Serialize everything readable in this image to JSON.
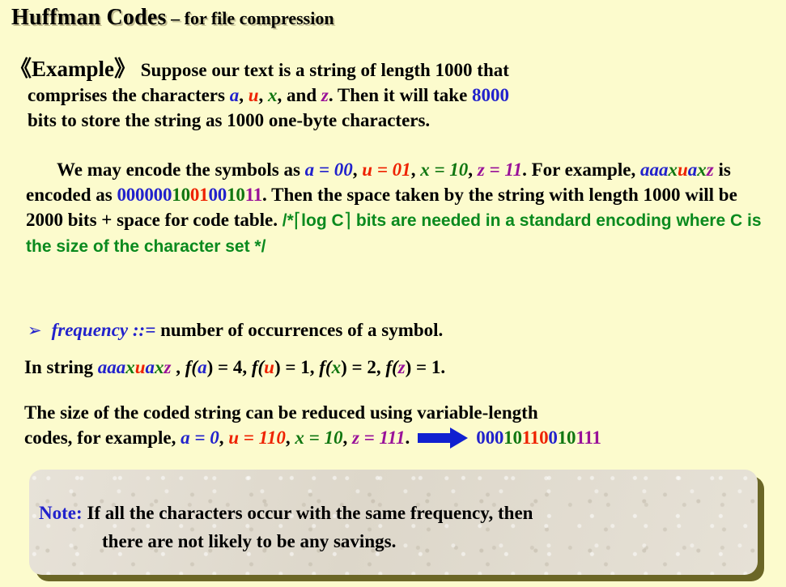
{
  "slide": {
    "background_color": "#fcfbcd",
    "title": {
      "main": "Huffman Codes",
      "dash": " – ",
      "subtitle": "for file compression"
    }
  },
  "colors": {
    "symbol_a": "#2222cc",
    "symbol_u": "#ee2200",
    "symbol_x": "#117711",
    "symbol_z": "#991199",
    "comment_green": "#0a8a1e",
    "accent_blue": "#2222cc",
    "note_shadow": "#6b6626",
    "note_bg": "#e3ded3"
  },
  "example": {
    "label": "《Example》",
    "line1_part1": "Suppose our text is a string of length 1000 that",
    "line2_part1": "comprises the characters  ",
    "sym_a": "a",
    "comma1": ", ",
    "sym_u": "u",
    "comma2": ", ",
    "sym_x": "x",
    "and": ", and ",
    "sym_z": "z",
    "line2_part2": ".  Then it will take   ",
    "bits_8000": "8000",
    "line3": "bits to store the string as 1000 one-byte characters."
  },
  "encoding": {
    "s1": "We may encode the symbols as ",
    "a_eq": "a = 00",
    "sep1": ", ",
    "u_eq": "u = 01",
    "sep2": ", ",
    "x_eq": "x = 10",
    "sep3": ", ",
    "z_eq": "z  = 11",
    "s2": ".   For example, ",
    "string_a1": "aaa",
    "string_x1": "x",
    "string_u1": "u",
    "string_a2": "a",
    "string_x2": "x",
    "string_z1": "z",
    "s3": " is encoded as ",
    "code_seg1": "000000",
    "code_seg2": "10",
    "code_seg3": "01",
    "code_seg4": "00",
    "code_seg5": "10",
    "code_seg6": "11",
    "s4": ".  Then the space taken by the string with length 1000 will be  2000 bits + space for code table.  ",
    "comment_open": "/*",
    "comment_ceil_open": "⌈",
    "comment_log": "log ",
    "comment_C": "C",
    "comment_ceil_close": "⌉",
    "comment_mid": " bits are needed in a standard encoding where ",
    "comment_C2": "C",
    "comment_tail": " is the size of the character set */"
  },
  "bullet": {
    "marker": "➢",
    "term": "frequency ::=",
    "definition": " number of occurrences of a symbol."
  },
  "in_string": {
    "prefix": "In string  ",
    "s_a1": "aaa",
    "s_x1": "x",
    "s_u1": "u",
    "s_a2": "a",
    "s_x2": "x",
    "s_z1": "z",
    "comma": " ,   ",
    "f_open": "f(",
    "fa_sym": "a",
    "fa_val": ") = 4,  ",
    "fu_sym": "u",
    "fu_val": ") = 1,  ",
    "fx_sym": "x",
    "fx_val": ") = 2,  ",
    "fz_sym": "z",
    "fz_val": ") = 1."
  },
  "varlen": {
    "line1": "The size of the coded string can be reduced using variable-length",
    "line2_prefix": "codes, for example, ",
    "a_eq": "a = 0",
    "sep1": ", ",
    "u_eq": "u = 110",
    "sep2": ", ",
    "x_eq": "x = 10",
    "sep3": ", ",
    "z_eq": "z  = 111",
    "period": ".",
    "arrow_icon": "right-arrow-icon",
    "result_seg1": "000",
    "result_seg2": "10",
    "result_seg3": "110",
    "result_seg4": "0",
    "result_seg5": "10",
    "result_seg6": "111"
  },
  "note": {
    "label": "Note:",
    "line1": " If all the characters occur with the same frequency, then",
    "line2": "there are not likely to be any savings."
  }
}
